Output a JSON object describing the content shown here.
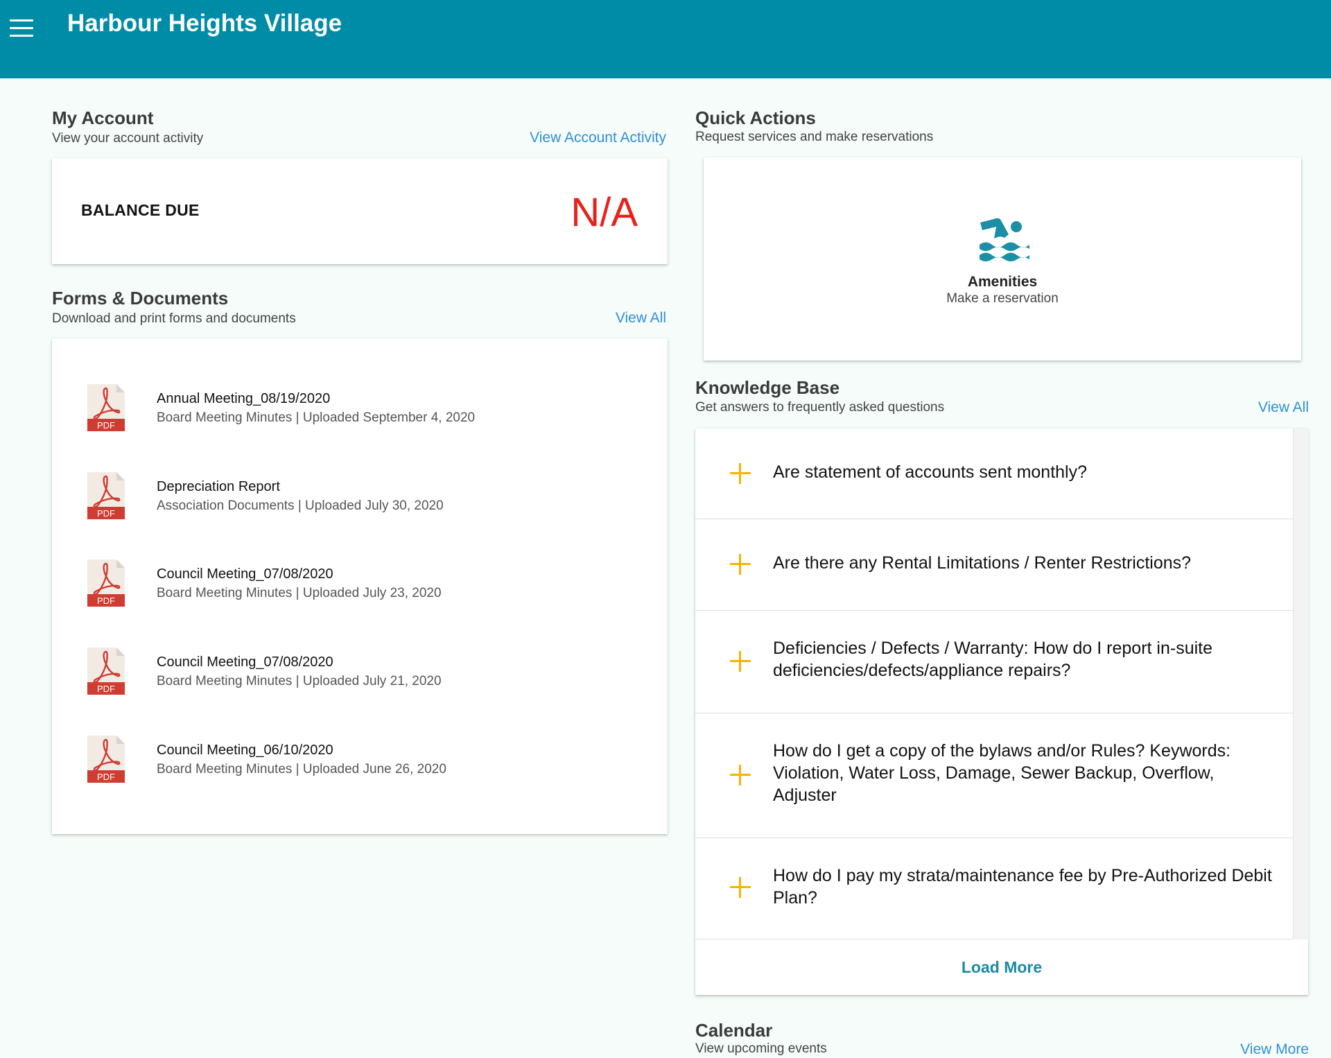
{
  "header": {
    "title": "Harbour Heights Village",
    "menu_icon": "hamburger-menu-icon",
    "background": "#008ca6"
  },
  "account": {
    "title": "My Account",
    "subtitle": "View your account activity",
    "link": "View Account Activity",
    "balance_label": "BALANCE DUE",
    "balance_value": "N/A",
    "balance_color": "#e8211a"
  },
  "documents": {
    "title": "Forms & Documents",
    "subtitle": "Download and print forms and documents",
    "link": "View All",
    "items": [
      {
        "title": "Annual Meeting_08/19/2020",
        "meta": "Board Meeting Minutes | Uploaded September 4, 2020",
        "badge": "PDF"
      },
      {
        "title": "Depreciation Report",
        "meta": "Association Documents | Uploaded July 30, 2020",
        "badge": "PDF"
      },
      {
        "title": "Council Meeting_07/08/2020",
        "meta": "Board Meeting Minutes | Uploaded July 23, 2020",
        "badge": "PDF"
      },
      {
        "title": "Council Meeting_07/08/2020",
        "meta": "Board Meeting Minutes | Uploaded July 21, 2020",
        "badge": "PDF"
      },
      {
        "title": "Council Meeting_06/10/2020",
        "meta": "Board Meeting Minutes | Uploaded June 26, 2020",
        "badge": "PDF"
      }
    ]
  },
  "quick_actions": {
    "title": "Quick Actions",
    "subtitle": "Request services and make reservations",
    "items": [
      {
        "icon": "swimmer-icon",
        "title": "Amenities",
        "subtitle": "Make a reservation"
      }
    ]
  },
  "knowledge_base": {
    "title": "Knowledge Base",
    "subtitle": "Get answers to frequently asked questions",
    "link": "View All",
    "items": [
      {
        "question": "Are statement of accounts sent monthly?"
      },
      {
        "question": "Are there any Rental Limitations / Renter Restrictions?"
      },
      {
        "question": "Deficiencies / Defects / Warranty: How do I report in-suite deficiencies/defects/appliance repairs?"
      },
      {
        "question": "How do I get a copy of the bylaws and/or Rules? Keywords: Violation, Water Loss, Damage, Sewer Backup, Overflow, Adjuster"
      },
      {
        "question": "How do I pay my strata/maintenance fee by Pre-Authorized Debit Plan?"
      }
    ],
    "load_more": "Load More"
  },
  "calendar": {
    "title": "Calendar",
    "subtitle": "View upcoming events",
    "link": "View More"
  },
  "colors": {
    "link": "#2f8fd6",
    "accent_plus": "#f4b400",
    "teal_icon": "#1a8fa5",
    "pdf_red": "#d03b32"
  }
}
